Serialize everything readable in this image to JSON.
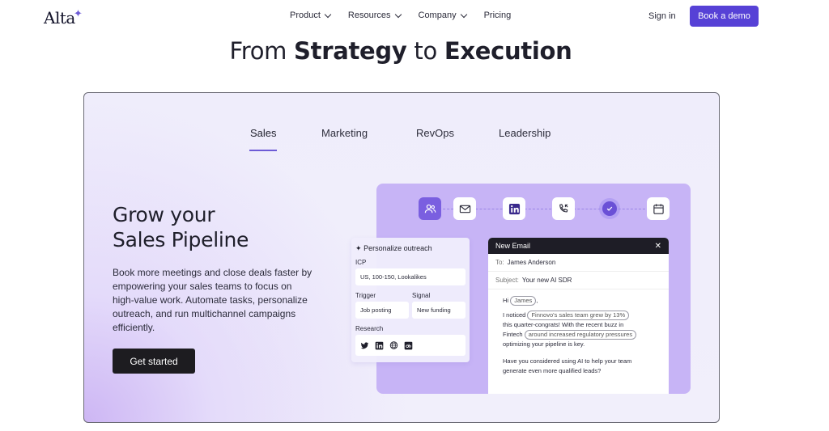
{
  "nav": {
    "logo": "Alta",
    "links": [
      {
        "label": "Product",
        "has_menu": true
      },
      {
        "label": "Resources",
        "has_menu": true
      },
      {
        "label": "Company",
        "has_menu": true
      },
      {
        "label": "Pricing",
        "has_menu": false
      }
    ],
    "sign_in": "Sign in",
    "book_demo": "Book a demo"
  },
  "hero": {
    "title_from": "From",
    "title_strategy": "Strategy",
    "title_to": "to",
    "title_execution": "Execution"
  },
  "tabs": [
    {
      "label": "Sales",
      "active": true
    },
    {
      "label": "Marketing",
      "active": false
    },
    {
      "label": "RevOps",
      "active": false
    },
    {
      "label": "Leadership",
      "active": false
    }
  ],
  "content": {
    "heading_line1": "Grow your",
    "heading_line2": "Sales Pipeline",
    "description": "Book more meetings and close deals faster by empowering your sales teams to focus on high-value work. Automate tasks, personalize outreach, and run multichannel campaigns efficiently.",
    "cta": "Get started"
  },
  "flow_icons": [
    "people-icon",
    "mail-icon",
    "linkedin-icon",
    "phone-icon",
    "check-icon",
    "calendar-icon"
  ],
  "panel": {
    "title": "Personalize outreach",
    "icp_label": "ICP",
    "icp_value": "US, 100-150, Lookalikes",
    "trigger_label": "Trigger",
    "trigger_value": "Job posting",
    "signal_label": "Signal",
    "signal_value": "New funding",
    "research_label": "Research"
  },
  "email": {
    "header": "New Email",
    "to_label": "To:",
    "to_value": "James Anderson",
    "subject_label": "Subject:",
    "subject_value": "Your new AI SDR",
    "greeting": "Hi",
    "name_pill": "James",
    "line1_pre": "I noticed",
    "pill_growth": "Finnovo's sales team grew by 13%",
    "line2": "this quarter-congrats! With the recent buzz in",
    "line3_pre": "Fintech",
    "pill_reg": "around increased regulatory pressures",
    "line4": "optimizing your pipeline is key.",
    "para2": "Have you considered using AI to help your team generate even more qualified leads?"
  },
  "colors": {
    "accent": "#5641d6",
    "card_bg": "#efedfb",
    "illus_bg": "#c7b4f6"
  }
}
